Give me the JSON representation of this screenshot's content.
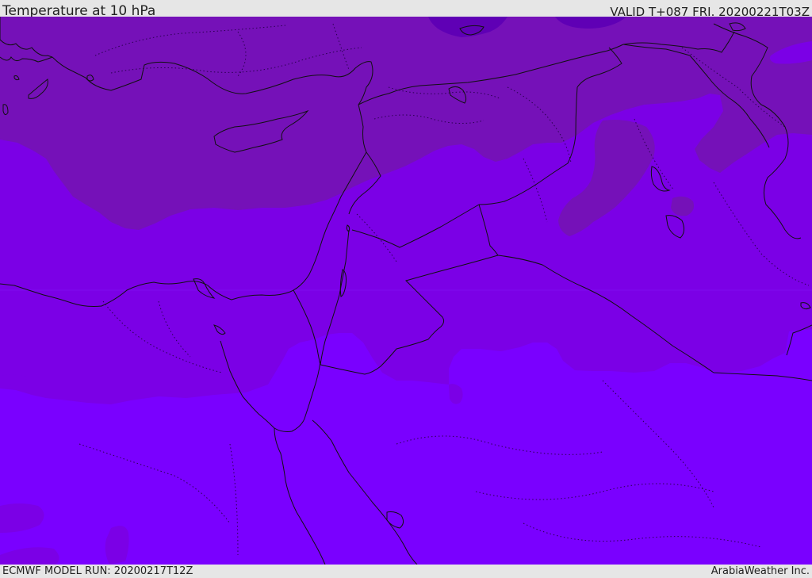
{
  "header": {
    "title": "Temperature at 10 hPa",
    "valid_time": "VALID T+087 FRI. 20200221T03Z"
  },
  "footer": {
    "model_run": "ECMWF MODEL RUN: 20200217T12Z",
    "credit": "ArabiaWeather Inc."
  },
  "colors": {
    "coldest_band": "#5f00b5",
    "cold_band": "#7511b8",
    "mid_band": "#7b00e6",
    "warm_band": "#7a00ff",
    "coastline": "#111111",
    "border": "#111111",
    "internal_border": "#222222",
    "label_bar": "#e6e6e6"
  },
  "map": {
    "region": "Eastern Mediterranean and Middle East",
    "layers": [
      "temperature-bands",
      "coastlines",
      "country-borders",
      "internal-borders"
    ]
  }
}
